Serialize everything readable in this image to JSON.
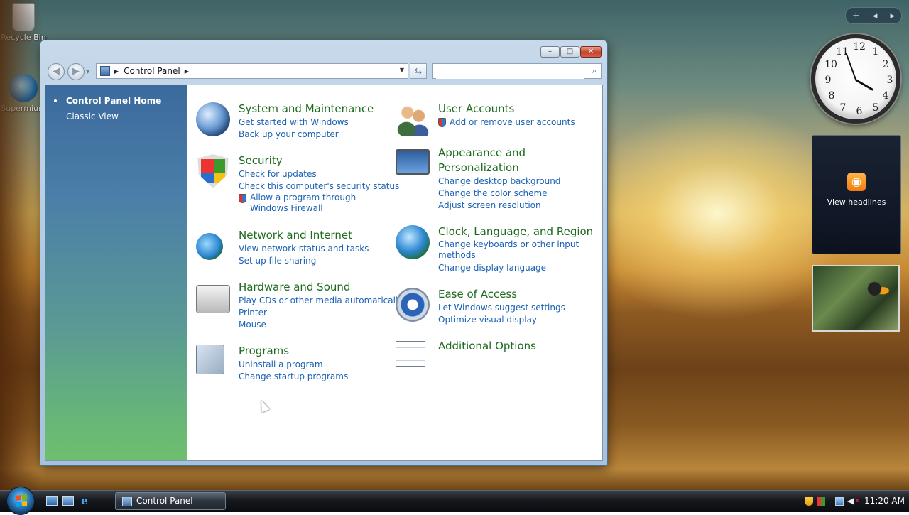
{
  "desktop": {
    "icons": [
      {
        "label": "Recycle Bin"
      },
      {
        "label": "Supermium"
      }
    ]
  },
  "gadgets": {
    "clock": {
      "numbers": [
        "12",
        "1",
        "2",
        "3",
        "4",
        "5",
        "6",
        "7",
        "8",
        "9",
        "10",
        "11"
      ]
    },
    "rss": {
      "label": "View headlines"
    },
    "toolbar": {
      "add": "+",
      "prev": "◂",
      "next": "▸"
    }
  },
  "window": {
    "controls": {
      "minimize": "–",
      "maximize": "□",
      "close": "✕"
    },
    "address": {
      "crumb": "Control Panel"
    },
    "search": {
      "value": "",
      "placeholder": ""
    },
    "task_pane": {
      "items": [
        {
          "label": "Control Panel Home"
        },
        {
          "label": "Classic View"
        }
      ]
    },
    "categories": {
      "system": {
        "title": "System and Maintenance",
        "links": [
          "Get started with Windows",
          "Back up your computer"
        ]
      },
      "security": {
        "title": "Security",
        "links": [
          "Check for updates",
          "Check this computer's security status",
          "Allow a program through Windows Firewall"
        ]
      },
      "network": {
        "title": "Network and Internet",
        "links": [
          "View network status and tasks",
          "Set up file sharing"
        ]
      },
      "hardware": {
        "title": "Hardware and Sound",
        "links": [
          "Play CDs or other media automatically",
          "Printer",
          "Mouse"
        ]
      },
      "programs": {
        "title": "Programs",
        "links": [
          "Uninstall a program",
          "Change startup programs"
        ]
      },
      "users": {
        "title": "User Accounts",
        "links": [
          "Add or remove user accounts"
        ]
      },
      "appearance": {
        "title_line1": "Appearance and",
        "title_line2": "Personalization",
        "links": [
          "Change desktop background",
          "Change the color scheme",
          "Adjust screen resolution"
        ]
      },
      "clock": {
        "title": "Clock, Language, and Region",
        "links": [
          "Change keyboards or other input methods",
          "Change display language"
        ]
      },
      "ease": {
        "title": "Ease of Access",
        "links": [
          "Let Windows suggest settings",
          "Optimize visual display"
        ]
      },
      "options": {
        "title": "Additional Options"
      }
    }
  },
  "taskbar": {
    "task_button": "Control Panel",
    "clock": "11:20 AM"
  },
  "colors": {
    "category_title": "#1d6b1d",
    "link": "#1b62b5"
  }
}
